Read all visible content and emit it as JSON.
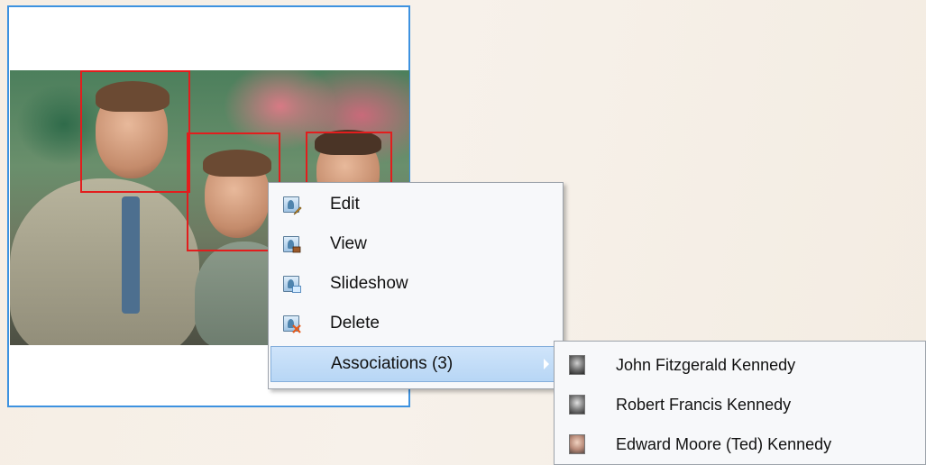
{
  "context_menu": {
    "items": [
      {
        "label": "Edit",
        "icon": "edit-icon"
      },
      {
        "label": "View",
        "icon": "view-icon"
      },
      {
        "label": "Slideshow",
        "icon": "slideshow-icon"
      },
      {
        "label": "Delete",
        "icon": "delete-icon"
      },
      {
        "label": "Associations (3)",
        "icon": "",
        "has_submenu": true,
        "active": true
      }
    ]
  },
  "associations_submenu": {
    "items": [
      {
        "label": "John Fitzgerald Kennedy",
        "icon": "person-thumbnail-icon"
      },
      {
        "label": "Robert Francis Kennedy",
        "icon": "person-thumbnail-icon"
      },
      {
        "label": "Edward Moore (Ted) Kennedy",
        "icon": "person-thumbnail-icon"
      }
    ]
  },
  "colors": {
    "card_border": "#3d92e0",
    "face_box": "#e21d1d",
    "menu_highlight": "#b7d6f5"
  }
}
